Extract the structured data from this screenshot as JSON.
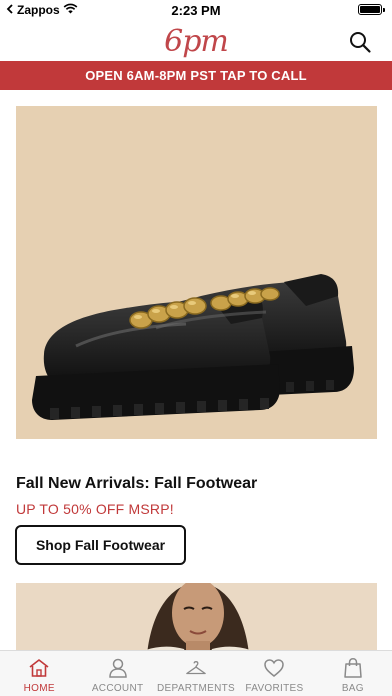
{
  "status_bar": {
    "carrier": "Zappos",
    "time": "2:23 PM",
    "battery_level": 1.0
  },
  "header": {
    "logo_text": "6pm",
    "search_icon": "search-icon",
    "brand_color": "#c0464a"
  },
  "promo_bar": {
    "text": "OPEN 6AM-8PM PST TAP TO CALL",
    "color": "#c1393a"
  },
  "hero": {
    "image_icon": "black-patent-loafer-with-gold-chain",
    "title": "Fall New Arrivals: Fall Footwear",
    "subtitle": "UP TO 50% OFF MSRP!",
    "button_label": "Shop Fall Footwear"
  },
  "secondary": {
    "image_icon": "woman-in-shearling-jacket"
  },
  "tab_bar": {
    "active_color": "#c1393a",
    "inactive_color": "#8a8a8a",
    "items": [
      {
        "label": "HOME",
        "icon": "home-icon"
      },
      {
        "label": "ACCOUNT",
        "icon": "account-icon"
      },
      {
        "label": "DEPARTMENTS",
        "icon": "hanger-icon"
      },
      {
        "label": "FAVORITES",
        "icon": "heart-icon"
      },
      {
        "label": "BAG",
        "icon": "bag-icon"
      }
    ]
  }
}
